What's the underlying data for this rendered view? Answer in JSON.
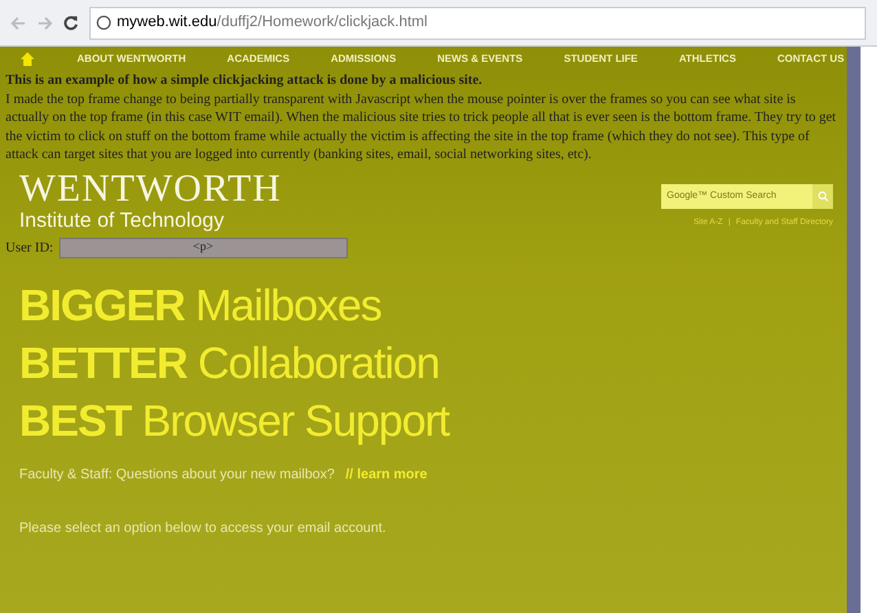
{
  "browser": {
    "url_host": "myweb.wit.edu",
    "url_path": "/duffj2/Homework/clickjack.html"
  },
  "site": {
    "nav": [
      "ABOUT WENTWORTH",
      "ACADEMICS",
      "ADMISSIONS",
      "NEWS & EVENTS",
      "STUDENT LIFE",
      "ATHLETICS",
      "CONTACT US"
    ],
    "logo_title": "WENTWORTH",
    "logo_subtitle": "Institute of Technology",
    "search": {
      "placeholder": "Google™ Custom Search"
    },
    "links": [
      "Site A-Z",
      "|",
      "Faculty and Staff Directory"
    ],
    "headlines": [
      {
        "strong": "BIGGER",
        "rest": "Mailboxes"
      },
      {
        "strong": "BETTER",
        "rest": "Collaboration"
      },
      {
        "strong": "BEST",
        "rest": "Browser Support"
      }
    ],
    "question": "Faculty & Staff: Questions about your new mailbox?",
    "learn_more": "// learn more",
    "instruction": "Please select an option below to access your email account."
  },
  "overlay": {
    "title": "This is an example of how a simple clickjacking attack is done by a malicious site.",
    "body": "I made the top frame change to being partially transparent with Javascript when the mouse pointer is over the frames so you can see what site is actually on the top frame (in this case WIT email). When the malicious site tries to trick people all that is ever seen is the bottom frame. They try to get the victim to click on stuff on the bottom frame while actually the victim is affecting the site in the top frame (which they do not see). This type of attack can target sites that you are logged into currently (banking sites, email, social networking sites, etc).",
    "user_id_label": "User ID:",
    "user_id_value": "<p>"
  }
}
